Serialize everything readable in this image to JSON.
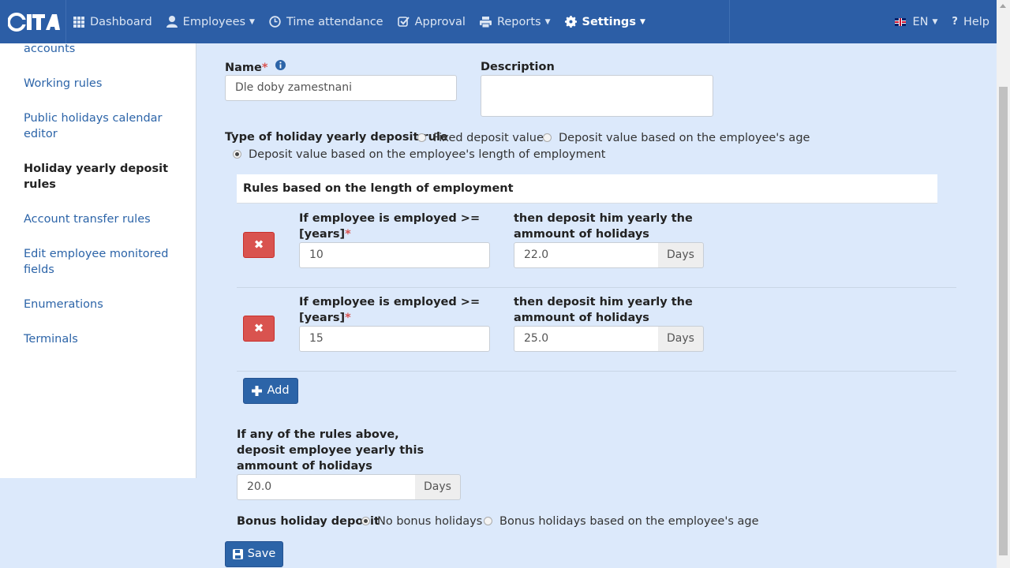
{
  "nav": {
    "logo": "iTA",
    "items": [
      {
        "label": "Dashboard",
        "icon": "grid-icon"
      },
      {
        "label": "Employees",
        "icon": "user-icon"
      },
      {
        "label": "Time attendance",
        "icon": "clock-icon"
      },
      {
        "label": "Approval",
        "icon": "check-square-icon"
      },
      {
        "label": "Reports",
        "icon": "printer-icon"
      },
      {
        "label": "Settings",
        "icon": "gear-icon"
      }
    ],
    "language": "EN",
    "help": "Help"
  },
  "sidebar": {
    "items": [
      {
        "label": "accounts"
      },
      {
        "label": "Working rules"
      },
      {
        "label": "Public holidays calendar editor"
      },
      {
        "label": "Holiday yearly deposit rules",
        "active": true
      },
      {
        "label": "Account transfer rules"
      },
      {
        "label": "Edit employee monitored fields"
      },
      {
        "label": "Enumerations"
      },
      {
        "label": "Terminals"
      }
    ]
  },
  "form": {
    "name_label": "Name",
    "required_mark": "*",
    "name_value": "Dle doby zamestnani",
    "description_label": "Description",
    "description_value": "",
    "type_label": "Type of holiday yearly deposit rule",
    "type_options": [
      {
        "label": "Fixed deposit value",
        "selected": false
      },
      {
        "label": "Deposit value based on the employee's age",
        "selected": false
      },
      {
        "label": "Deposit value based on the employee's length of employment",
        "selected": true
      }
    ],
    "rules_panel_title": "Rules based on the length of employment",
    "rule_condition_label": "If employee is employed >= [years]",
    "rule_deposit_label": "then deposit him yearly the ammount of holidays",
    "days_unit": "Days",
    "rules": [
      {
        "years": "10",
        "days": "22.0"
      },
      {
        "years": "15",
        "days": "25.0"
      }
    ],
    "add_button": "Add",
    "default_label": "If any of the rules above, deposit employee yearly this ammount of holidays",
    "default_value": "20.0",
    "bonus_label": "Bonus holiday deposit",
    "bonus_options": [
      {
        "label": "No bonus holidays",
        "selected": true
      },
      {
        "label": "Bonus holidays based on the employee's age",
        "selected": false
      }
    ],
    "save_button": "Save"
  },
  "colors": {
    "navbar": "#2c5ea6",
    "page_bg": "#dce9fb",
    "danger": "#d9534f",
    "primary": "#2c64a8",
    "link": "#2c64a8"
  }
}
